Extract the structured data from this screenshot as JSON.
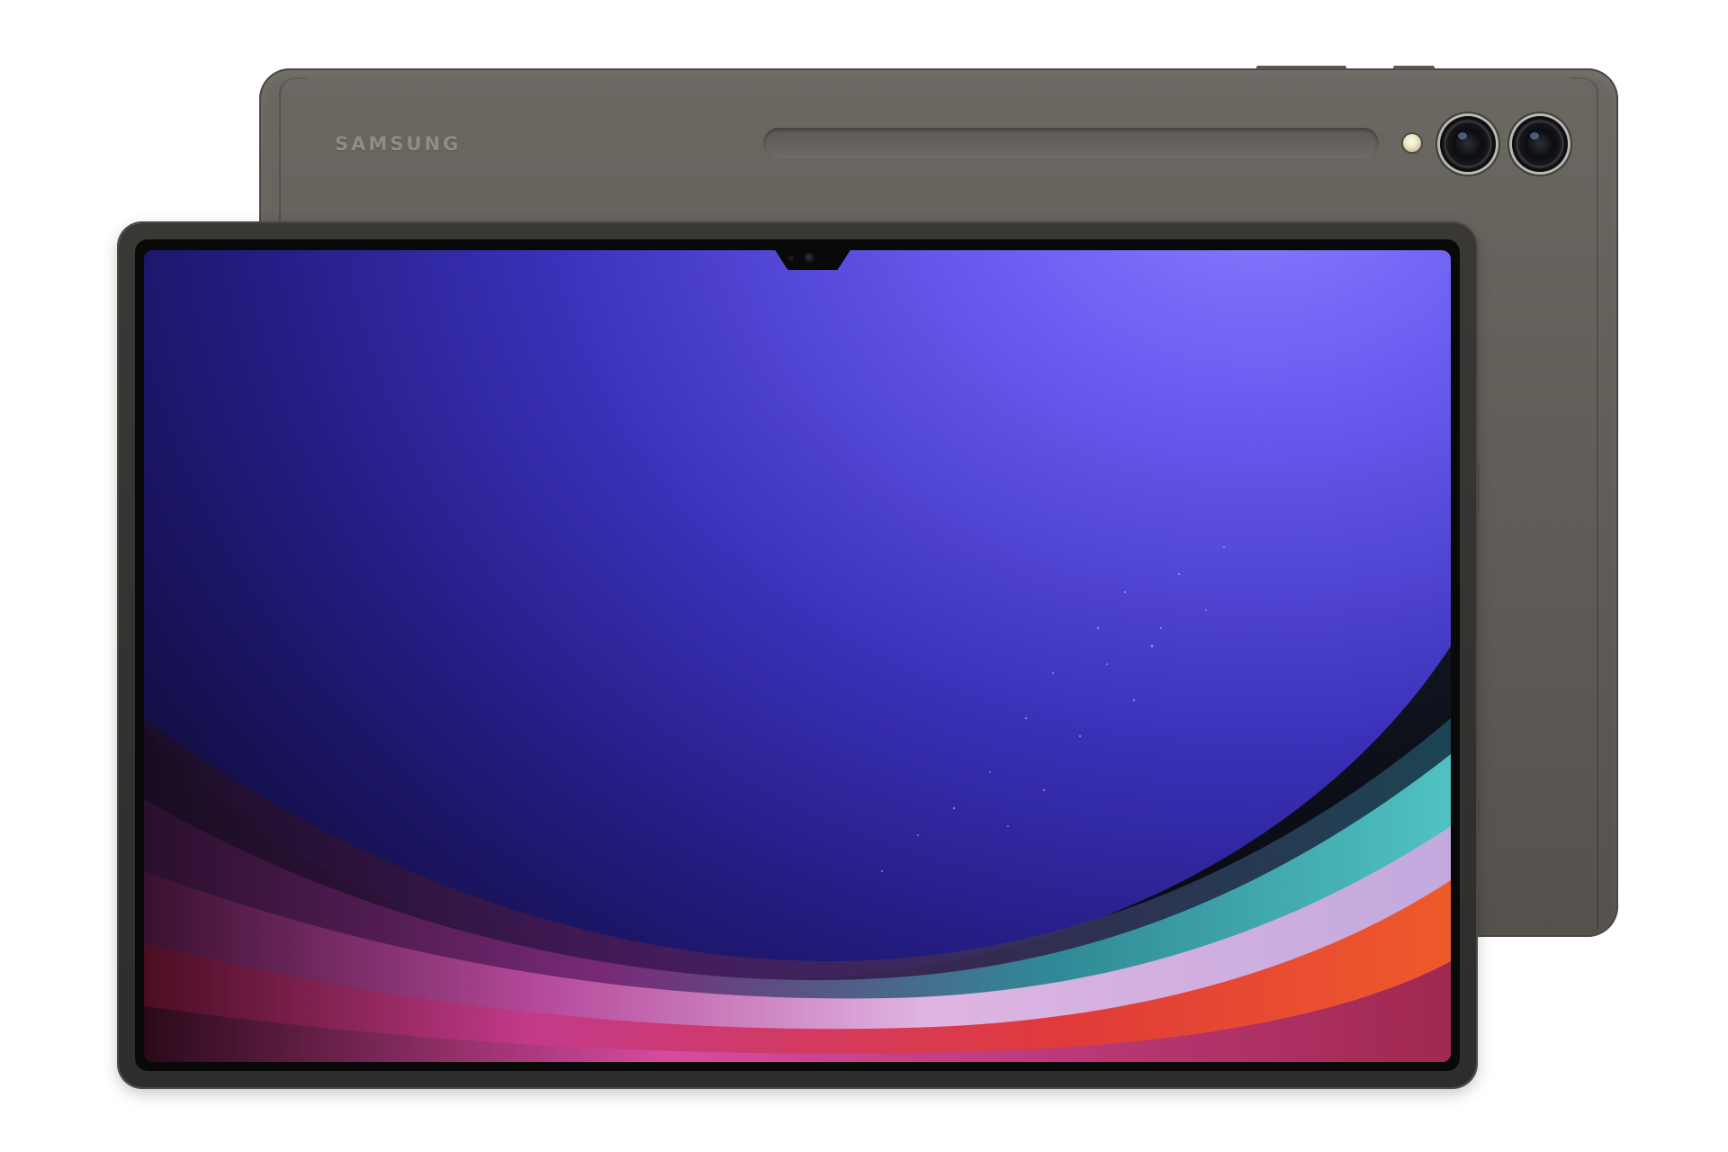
{
  "back_tablet": {
    "brand": "SAMSUNG",
    "color": "#615e59"
  },
  "front_tablet": {
    "frame_color": "#33312e",
    "wallpaper_colors": [
      "#2b2590",
      "#6a5cf0",
      "#c43a8a",
      "#e03a3a",
      "#2fa0a8"
    ]
  },
  "icons": {
    "rear_camera_1": "rear-camera-icon",
    "rear_camera_2": "rear-camera-icon",
    "flash": "flash-icon",
    "front_camera": "front-camera-icon"
  }
}
